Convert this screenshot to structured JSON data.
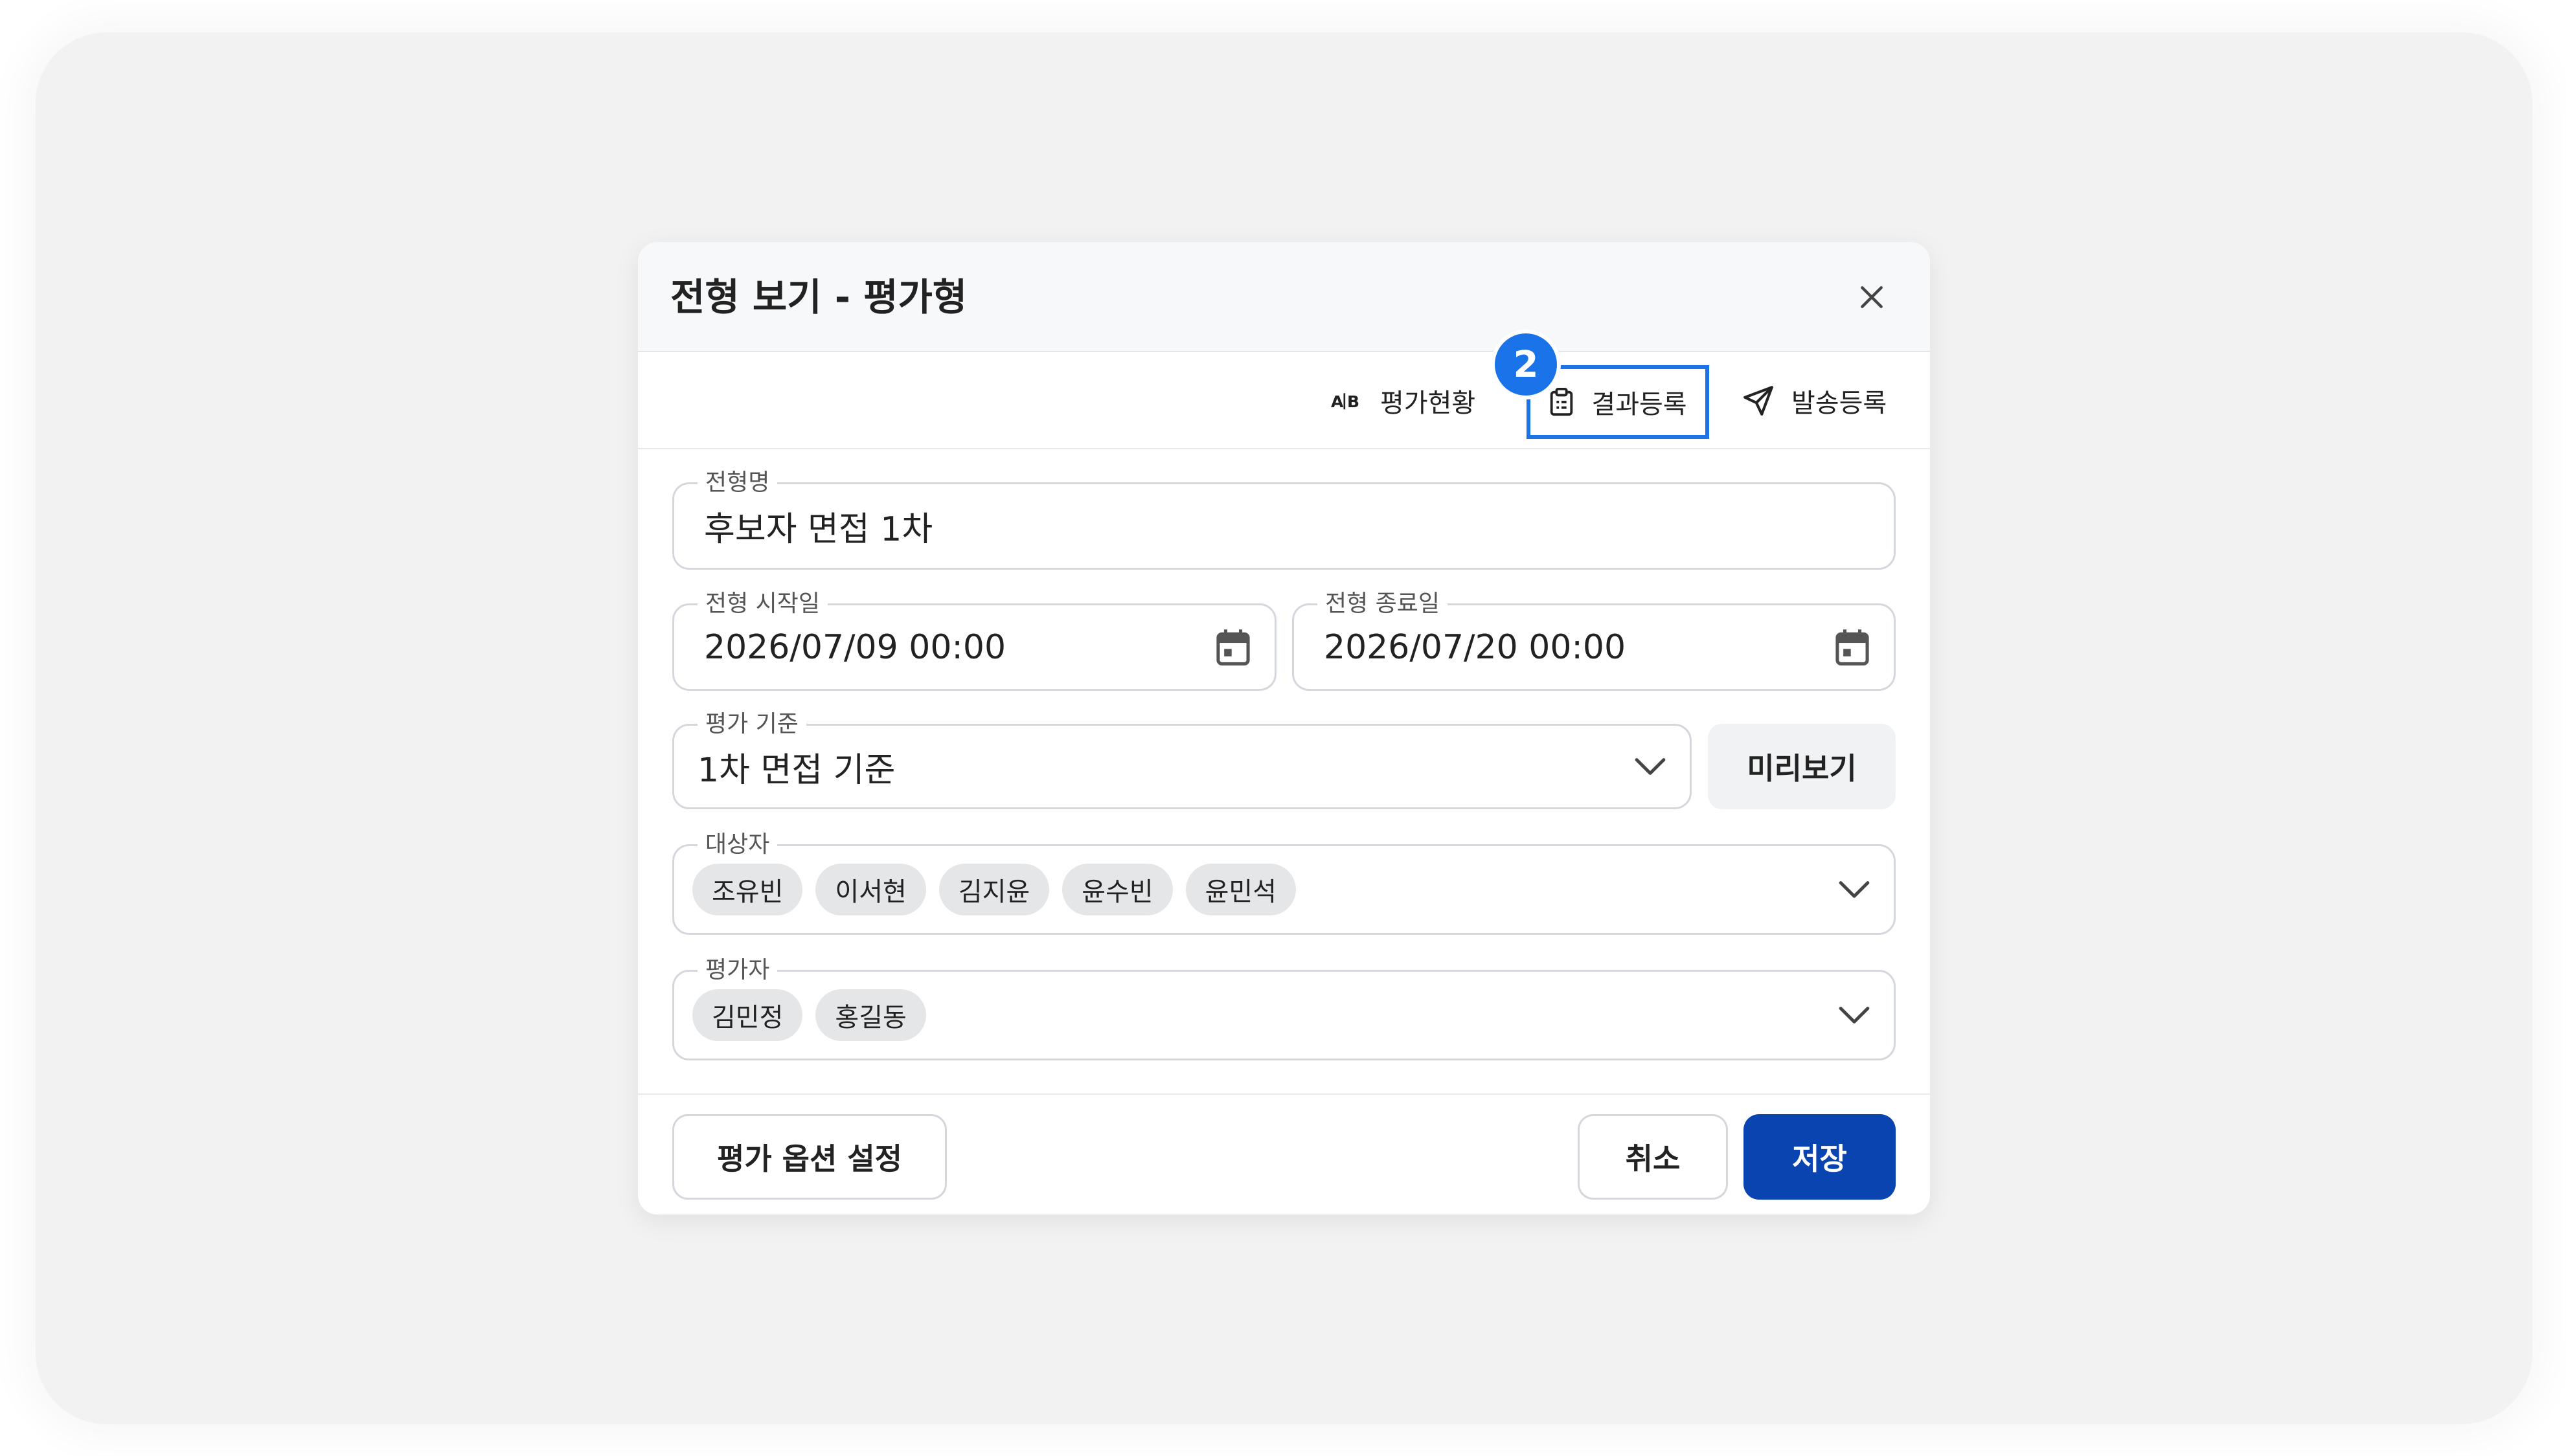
{
  "dialog": {
    "title": "전형 보기 - 평가형"
  },
  "toolbar": {
    "step_number": "2",
    "items": [
      {
        "label": "평가현황",
        "icon": "ab-test-icon"
      },
      {
        "label": "결과등록",
        "icon": "clipboard-icon"
      },
      {
        "label": "발송등록",
        "icon": "send-icon"
      }
    ]
  },
  "form": {
    "stage_name": {
      "label": "전형명",
      "value": "후보자 면접 1차"
    },
    "start_date": {
      "label": "전형 시작일",
      "value": "2026/07/09 00:00"
    },
    "end_date": {
      "label": "전형 종료일",
      "value": "2026/07/20 00:00"
    },
    "criteria": {
      "label": "평가 기준",
      "value": "1차 면접 기준",
      "preview_label": "미리보기"
    },
    "targets": {
      "label": "대상자",
      "chips": [
        "조유빈",
        "이서현",
        "김지윤",
        "윤수빈",
        "윤민석"
      ]
    },
    "evaluators": {
      "label": "평가자",
      "chips": [
        "김민정",
        "홍길동"
      ]
    }
  },
  "footer": {
    "options_label": "평가 옵션 설정",
    "cancel_label": "취소",
    "save_label": "저장"
  },
  "colors": {
    "accent": "#1a73e8",
    "primary_button": "#0a44b0",
    "backdrop": "#f2f2f3",
    "border": "#d4d7dc"
  }
}
